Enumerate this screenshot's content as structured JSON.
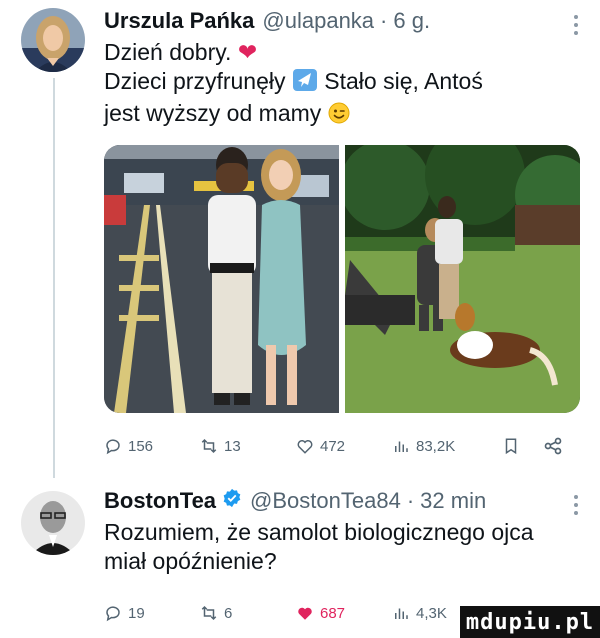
{
  "post1": {
    "name": "Urszula Pańka",
    "handle": "@ulapanka",
    "separator": "·",
    "time": "6 g.",
    "lines": [
      "Dzień dobry.",
      "Dzieci przyfrunęły",
      "Stało się, Antoś",
      "jest wyższy od mamy"
    ],
    "heart_emoji": "❤",
    "stats": {
      "replies": "156",
      "reposts": "13",
      "likes": "472",
      "views": "83,2K"
    }
  },
  "post2": {
    "name": "BostonTea",
    "handle": "@BostonTea84",
    "separator": "·",
    "time": "32 min",
    "lines": [
      "Rozumiem, że samolot biologicznego ojca",
      "miał opóźnienie?"
    ],
    "stats": {
      "replies": "19",
      "reposts": "6",
      "likes": "687",
      "views": "4,3K"
    }
  },
  "watermark": "mdupiu.pl",
  "colors": {
    "like_active": "#e0245e",
    "verified": "#1d9bf0",
    "secondary_text": "#536471",
    "thread_line": "#cfd9de"
  },
  "icons": [
    "reply-icon",
    "repost-icon",
    "like-icon",
    "views-icon",
    "bookmark-icon",
    "share-icon",
    "verified-badge-icon",
    "more-icon",
    "airplane-emoji",
    "winking-face-emoji"
  ]
}
